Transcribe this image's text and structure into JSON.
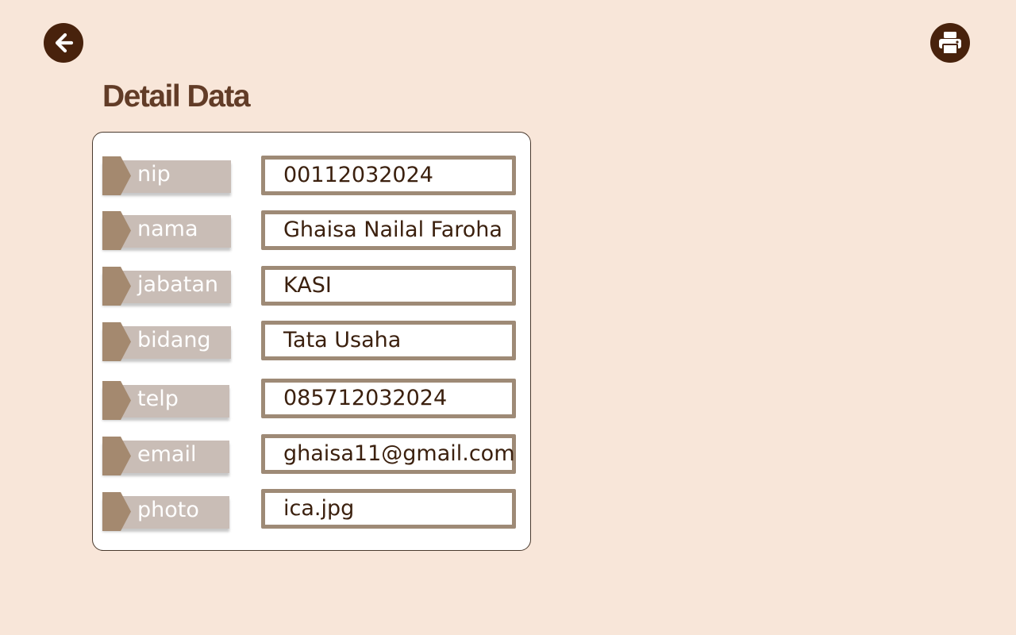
{
  "header": {
    "back_icon": "arrow-left-circle-icon",
    "print_icon": "printer-icon",
    "title": "Detail Data"
  },
  "fields": [
    {
      "label": "nip",
      "value": "00112032024"
    },
    {
      "label": "nama",
      "value": "Ghaisa Nailal Faroha"
    },
    {
      "label": "jabatan",
      "value": "KASI"
    },
    {
      "label": "bidang",
      "value": "Tata Usaha"
    },
    {
      "label": "telp",
      "value": "085712032024"
    },
    {
      "label": "email",
      "value": "ghaisa11@gmail.com"
    },
    {
      "label": "photo",
      "value": "ica.jpg"
    }
  ],
  "colors": {
    "background": "#f8e6d9",
    "icon_button": "#48220c",
    "title": "#623c27",
    "label_tag": "#c9bdb6",
    "label_arrow": "#a4896f",
    "value_border": "#9e8a76",
    "value_text": "#3b200e"
  }
}
